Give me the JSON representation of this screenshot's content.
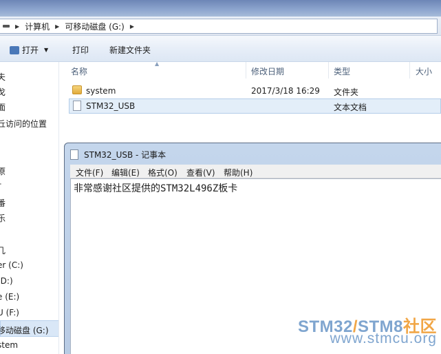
{
  "explorer": {
    "breadcrumb": [
      "计算机",
      "可移动磁盘 (G:)"
    ],
    "toolbar": {
      "open": "打开",
      "print": "打印",
      "new_folder": "新建文件夹"
    },
    "nav": [
      "夫",
      "戈",
      "面",
      "丘访问的位置",
      "原",
      "†",
      "番",
      "乐",
      "几",
      "er (C:)",
      "(D:)",
      "e (E:)",
      "U (F:)",
      "移动磁盘 (G:)",
      "stem"
    ],
    "columns": {
      "name": "名称",
      "date": "修改日期",
      "type": "类型",
      "size": "大小"
    },
    "files": [
      {
        "name": "system",
        "date": "2017/3/18 16:29",
        "type": "文件夹",
        "icon": "folder-icon"
      },
      {
        "name": "STM32_USB",
        "date": "",
        "type": "文本文档",
        "icon": "text-file-icon"
      }
    ]
  },
  "notepad": {
    "title": "STM32_USB - 记事本",
    "menus": [
      "文件(F)",
      "编辑(E)",
      "格式(O)",
      "查看(V)",
      "帮助(H)"
    ],
    "content": "非常感谢社区提供的STM32L496Z板卡"
  },
  "watermark": {
    "line1_a": "STM32",
    "line1_b": "/",
    "line1_c": "STM8",
    "line1_d": "社区",
    "line2": "www.stmcu.org"
  }
}
